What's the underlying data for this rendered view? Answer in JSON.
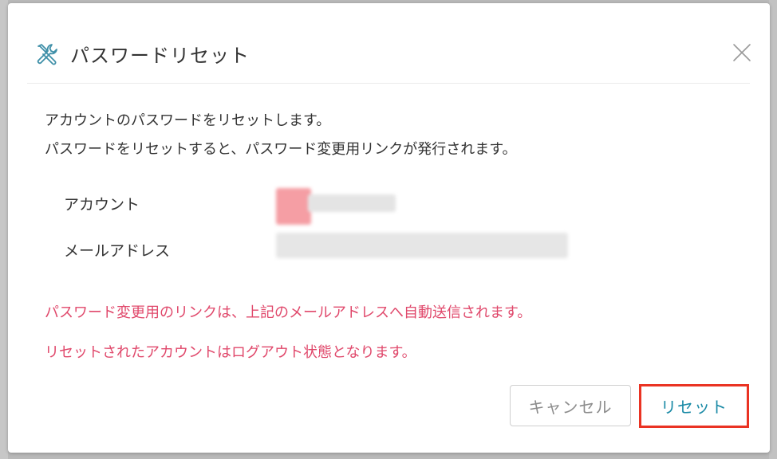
{
  "dialog": {
    "title": "パスワードリセット",
    "title_icon": "tools-icon",
    "close_icon": "close-icon"
  },
  "body": {
    "description": [
      "アカウントのパスワードをリセットします。",
      "パスワードをリセットすると、パスワード変更用リンクが発行されます。"
    ],
    "account_label": "アカウント",
    "email_label": "メールアドレス",
    "warnings": [
      "パスワード変更用のリンクは、上記のメールアドレスへ自動送信されます。",
      "リセットされたアカウントはログアウト状態となります。"
    ]
  },
  "footer": {
    "cancel_label": "キャンセル",
    "reset_label": "リセット"
  },
  "colors": {
    "warning": "#e0486b",
    "primary": "#1a8aa6",
    "highlight": "#ea3323"
  }
}
